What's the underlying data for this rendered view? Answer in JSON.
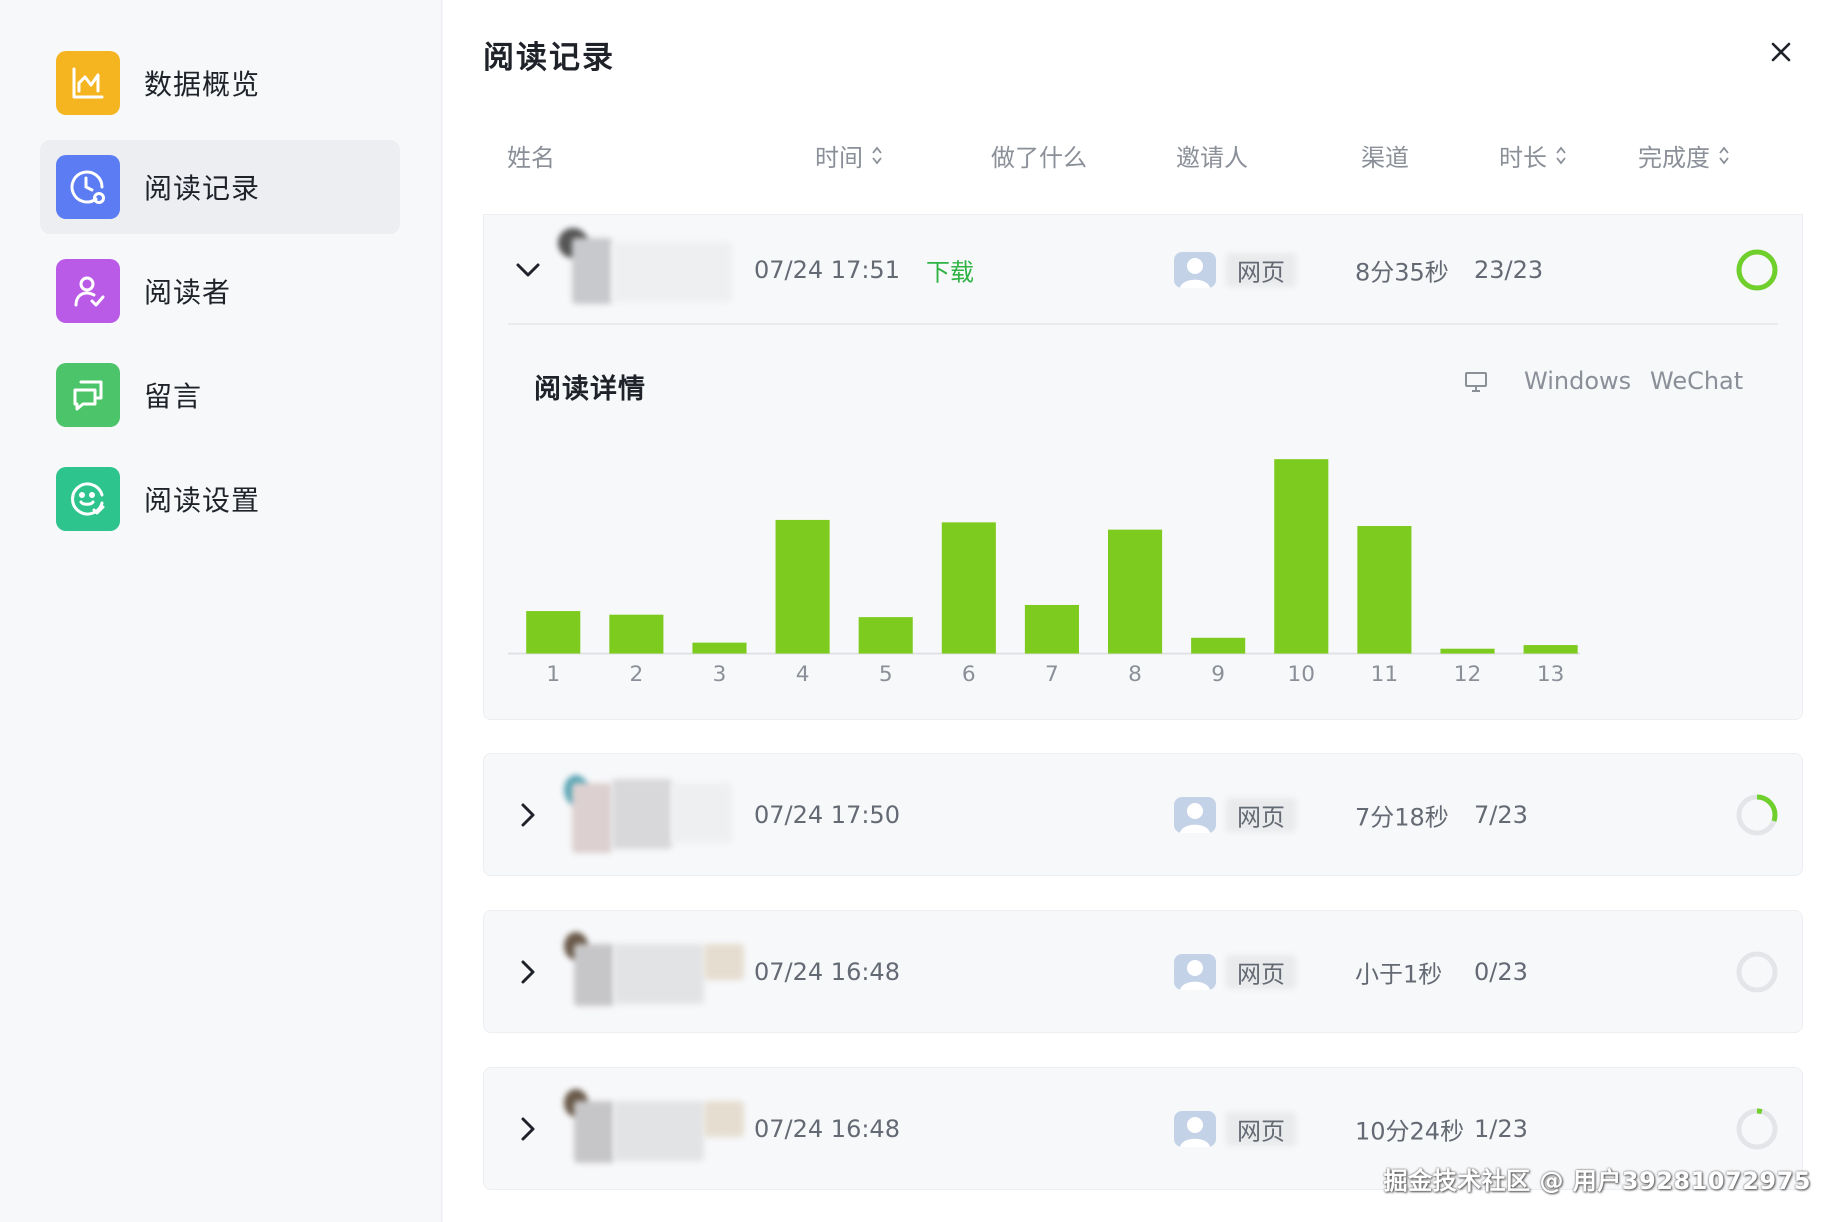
{
  "sidebar": {
    "items": [
      {
        "label": "数据概览",
        "icon": "chart-icon",
        "color": "#f5b521",
        "active": false
      },
      {
        "label": "阅读记录",
        "icon": "clock-icon",
        "color": "#5b7cf2",
        "active": true
      },
      {
        "label": "阅读者",
        "icon": "reader-icon",
        "color": "#b95be6",
        "active": false
      },
      {
        "label": "留言",
        "icon": "message-icon",
        "color": "#4cc46a",
        "active": false
      },
      {
        "label": "阅读设置",
        "icon": "smile-icon",
        "color": "#2ec48e",
        "active": false
      }
    ]
  },
  "main": {
    "title": "阅读记录",
    "columns": {
      "name": "姓名",
      "time": "时间",
      "action": "做了什么",
      "inviter": "邀请人",
      "channel": "渠道",
      "duration": "时长",
      "completion": "完成度"
    },
    "rows": [
      {
        "time": "07/24 17:51",
        "action": "下载",
        "channel": "网页",
        "duration": "8分35秒",
        "completion": "23/23",
        "progress": 1.0,
        "expanded": true
      },
      {
        "time": "07/24 17:50",
        "action": "",
        "channel": "网页",
        "duration": "7分18秒",
        "completion": "7/23",
        "progress": 0.304,
        "expanded": false
      },
      {
        "time": "07/24 16:48",
        "action": "",
        "channel": "网页",
        "duration": "小于1秒",
        "completion": "0/23",
        "progress": 0.0,
        "expanded": false
      },
      {
        "time": "07/24 16:48",
        "action": "",
        "channel": "网页",
        "duration": "10分24秒",
        "completion": "1/23",
        "progress": 0.043,
        "expanded": false
      }
    ],
    "detail": {
      "title": "阅读详情",
      "os": "Windows",
      "app": "WeChat"
    }
  },
  "chart_data": {
    "type": "bar",
    "categories": [
      "1",
      "2",
      "3",
      "4",
      "5",
      "6",
      "7",
      "8",
      "9",
      "10",
      "11",
      "12",
      "13"
    ],
    "values": [
      35,
      32,
      9,
      110,
      30,
      108,
      40,
      102,
      13,
      160,
      105,
      4,
      7
    ],
    "ylim": [
      0,
      170
    ],
    "color": "#7ecb20",
    "grid": false
  },
  "watermark": "掘金技术社区 @ 用户39281072975",
  "colors": {
    "accent_green": "#7ecb20",
    "action_green": "#2fb344",
    "progress_green": "#6fcf2b",
    "progress_track": "#e3e5e8"
  }
}
